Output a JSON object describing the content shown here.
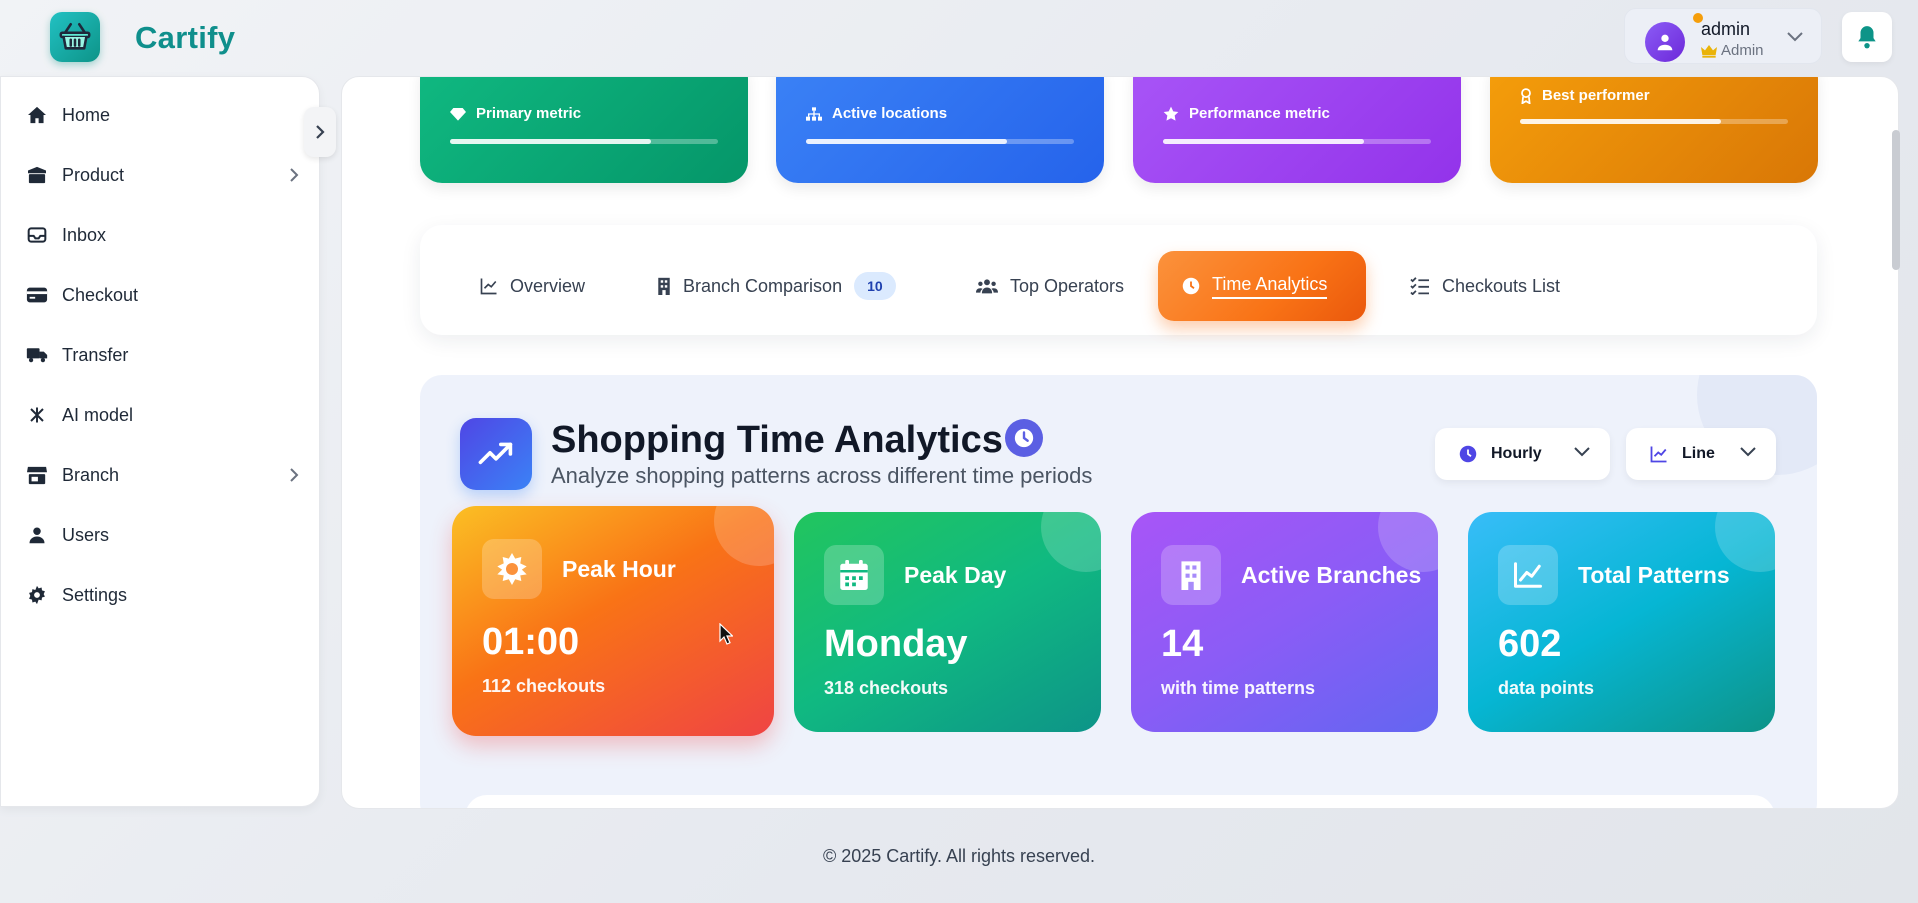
{
  "brand": {
    "name": "Cartify"
  },
  "user": {
    "name": "admin",
    "role": "Admin"
  },
  "sidebar": {
    "items": [
      {
        "label": "Home",
        "icon": "home-icon"
      },
      {
        "label": "Product",
        "icon": "box-icon",
        "expandable": true
      },
      {
        "label": "Inbox",
        "icon": "inbox-icon"
      },
      {
        "label": "Checkout",
        "icon": "credit-card-icon"
      },
      {
        "label": "Transfer",
        "icon": "truck-icon"
      },
      {
        "label": "AI model",
        "icon": "network-icon"
      },
      {
        "label": "Branch",
        "icon": "store-icon",
        "expandable": true
      },
      {
        "label": "Users",
        "icon": "user-icon"
      },
      {
        "label": "Settings",
        "icon": "gear-icon"
      }
    ]
  },
  "metrics": [
    {
      "label": "Primary metric",
      "icon": "diamond-icon",
      "progress": 0.75,
      "color": "#10b981"
    },
    {
      "label": "Active locations",
      "icon": "sitemap-icon",
      "progress": 0.75,
      "color": "#3b82f6"
    },
    {
      "label": "Performance metric",
      "icon": "star-icon",
      "progress": 0.75,
      "color": "#a855f7"
    },
    {
      "label": "Best performer",
      "icon": "award-icon",
      "progress": 0.75,
      "color": "#f59e0b"
    }
  ],
  "tabs": [
    {
      "label": "Overview",
      "icon": "line-chart-icon",
      "active": false
    },
    {
      "label": "Branch Comparison",
      "icon": "building-icon",
      "badge": "10",
      "active": false
    },
    {
      "label": "Top Operators",
      "icon": "users-icon",
      "active": false
    },
    {
      "label": "Time Analytics",
      "icon": "clock-icon",
      "active": true
    },
    {
      "label": "Checkouts List",
      "icon": "list-check-icon",
      "active": false
    }
  ],
  "analytics": {
    "title": "Shopping Time Analytics",
    "subtitle": "Analyze shopping patterns across different time periods",
    "period_select": "Hourly",
    "chart_select": "Line"
  },
  "stats": [
    {
      "title": "Peak Hour",
      "value": "01:00",
      "note": "112 checkouts",
      "icon": "sun-icon"
    },
    {
      "title": "Peak Day",
      "value": "Monday",
      "note": "318 checkouts",
      "icon": "calendar-icon"
    },
    {
      "title": "Active Branches",
      "value": "14",
      "note": "with time patterns",
      "icon": "building-icon"
    },
    {
      "title": "Total Patterns",
      "value": "602",
      "note": "data points",
      "icon": "chart-line-icon"
    }
  ],
  "footer": {
    "text": "© 2025 Cartify. All rights reserved."
  },
  "colors": {
    "accent": "#0f8f8c",
    "active_tab": "#f97316"
  }
}
